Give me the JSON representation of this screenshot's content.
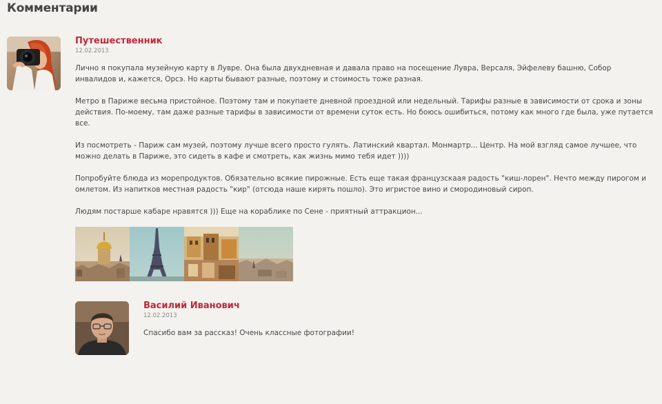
{
  "section": {
    "title": "Комментарии"
  },
  "comments": [
    {
      "author": "Путешественник",
      "date": "12.02.2013",
      "paragraphs": [
        "Лично я покупала музейную карту в Лувре. Она была двухдневная и давала право на посещение Лувра, Версаля, Эйфелеву башню, Собор инвалидов и, кажется, Орсэ. Но карты бывают разные, поэтому и стоимость тоже разная.",
        "Метро в Париже весьма пристойное. Поэтому там и покупаете дневной проездной или недельный. Тарифы разные в зависимости от срока и зоны действия. По-моему, там даже разные тарифы в зависимости от времени суток есть. Но боюсь ошибиться, потому как много где была, уже путается все.",
        "Из посмотреть - Париж сам музей, поэтому лучше всего просто гулять. Латинский квартал. Монмартр... Центр. На мой взгляд самое лучшее, что можно делать в Париже, это сидеть в кафе и смотреть, как жизнь мимо тебя идет ))))",
        "Попробуйте блюда из морепродуктов. Обязательно всякие пирожные. Есть еще такая французскаая радость \"киш-лорен\". Нечто между пирогом и омлетом. Из напитков местная радость \"кир\" (отсюда наше кирять пошло). Это игристое вино и смородиновый сироп.",
        "Людям постарше кабаре нравятся ))) Еще на кораблике по Сене - приятный аттракцион..."
      ],
      "photos": [
        "les-invalides-dome",
        "eiffel-tower",
        "paris-rooftops",
        "notre-dame-view"
      ]
    },
    {
      "author": "Василий Иванович",
      "date": "12.02.2013",
      "paragraphs": [
        "Спасибо вам за рассказ! Очень классные фотографии!"
      ]
    }
  ],
  "colors": {
    "background": "#f4f2ee",
    "author": "#c0283b",
    "text": "#474747",
    "date": "#8a8a8a"
  }
}
